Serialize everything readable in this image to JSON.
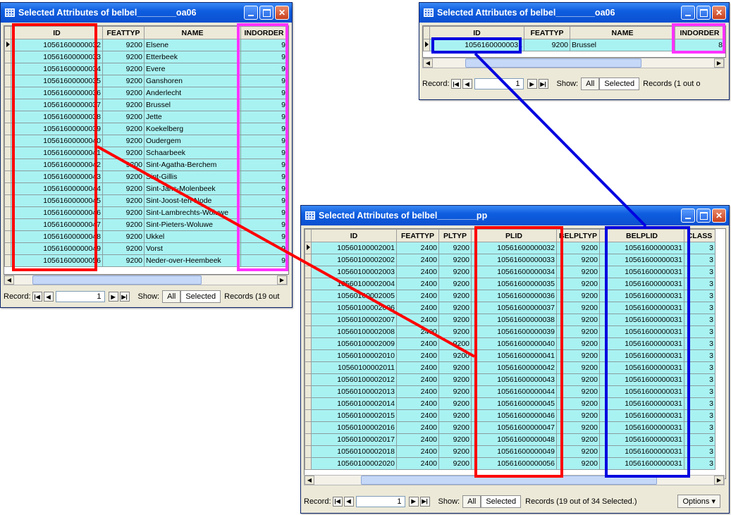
{
  "windows": {
    "oa06_left": {
      "title": "Selected Attributes of belbel________oa06",
      "columns": [
        "ID",
        "FEATTYP",
        "NAME",
        "INDORDER"
      ],
      "rows": [
        [
          "10561600000032",
          "9200",
          "Elsene",
          "9"
        ],
        [
          "10561600000033",
          "9200",
          "Etterbeek",
          "9"
        ],
        [
          "10561600000034",
          "9200",
          "Evere",
          "9"
        ],
        [
          "10561600000035",
          "9200",
          "Ganshoren",
          "9"
        ],
        [
          "10561600000036",
          "9200",
          "Anderlecht",
          "9"
        ],
        [
          "10561600000037",
          "9200",
          "Brussel",
          "9"
        ],
        [
          "10561600000038",
          "9200",
          "Jette",
          "9"
        ],
        [
          "10561600000039",
          "9200",
          "Koekelberg",
          "9"
        ],
        [
          "10561600000040",
          "9200",
          "Oudergem",
          "9"
        ],
        [
          "10561600000041",
          "9200",
          "Schaarbeek",
          "9"
        ],
        [
          "10561600000042",
          "9200",
          "Sint-Agatha-Berchem",
          "9"
        ],
        [
          "10561600000043",
          "9200",
          "Sint-Gillis",
          "9"
        ],
        [
          "10561600000044",
          "9200",
          "Sint-Jans-Molenbeek",
          "9"
        ],
        [
          "10561600000045",
          "9200",
          "Sint-Joost-ten-Node",
          "9"
        ],
        [
          "10561600000046",
          "9200",
          "Sint-Lambrechts-Woluwe",
          "9"
        ],
        [
          "10561600000047",
          "9200",
          "Sint-Pieters-Woluwe",
          "9"
        ],
        [
          "10561600000048",
          "9200",
          "Ukkel",
          "9"
        ],
        [
          "10561600000049",
          "9200",
          "Vorst",
          "9"
        ],
        [
          "10561600000056",
          "9200",
          "Neder-over-Heembeek",
          "9"
        ]
      ],
      "status": {
        "record_label": "Record:",
        "record_value": "1",
        "show_label": "Show:",
        "all_label": "All",
        "selected_label": "Selected",
        "records_text": "Records (19 out"
      }
    },
    "oa06_right": {
      "title": "Selected Attributes of belbel________oa06",
      "columns": [
        "ID",
        "FEATTYP",
        "NAME",
        "INDORDER"
      ],
      "rows": [
        [
          "10561600000031",
          "9200",
          "Brussel",
          "8"
        ]
      ],
      "status": {
        "record_label": "Record:",
        "record_value": "1",
        "show_label": "Show:",
        "all_label": "All",
        "selected_label": "Selected",
        "records_text": "Records (1 out o"
      }
    },
    "pp": {
      "title": "Selected Attributes of belbel________pp",
      "columns": [
        "ID",
        "FEATTYP",
        "PLTYP",
        "PLID",
        "BELPLTYP",
        "BELPLID",
        "CLASS"
      ],
      "rows": [
        [
          "10560100002001",
          "2400",
          "9200",
          "10561600000032",
          "9200",
          "10561600000031",
          "3"
        ],
        [
          "10560100002002",
          "2400",
          "9200",
          "10561600000033",
          "9200",
          "10561600000031",
          "3"
        ],
        [
          "10560100002003",
          "2400",
          "9200",
          "10561600000034",
          "9200",
          "10561600000031",
          "3"
        ],
        [
          "10560100002004",
          "2400",
          "9200",
          "10561600000035",
          "9200",
          "10561600000031",
          "3"
        ],
        [
          "10560100002005",
          "2400",
          "9200",
          "10561600000036",
          "9200",
          "10561600000031",
          "3"
        ],
        [
          "10560100002006",
          "2400",
          "9200",
          "10561600000037",
          "9200",
          "10561600000031",
          "3"
        ],
        [
          "10560100002007",
          "2400",
          "9200",
          "10561600000038",
          "9200",
          "10561600000031",
          "3"
        ],
        [
          "10560100002008",
          "2400",
          "9200",
          "10561600000039",
          "9200",
          "10561600000031",
          "3"
        ],
        [
          "10560100002009",
          "2400",
          "9200",
          "10561600000040",
          "9200",
          "10561600000031",
          "3"
        ],
        [
          "10560100002010",
          "2400",
          "9200",
          "10561600000041",
          "9200",
          "10561600000031",
          "3"
        ],
        [
          "10560100002011",
          "2400",
          "9200",
          "10561600000042",
          "9200",
          "10561600000031",
          "3"
        ],
        [
          "10560100002012",
          "2400",
          "9200",
          "10561600000043",
          "9200",
          "10561600000031",
          "3"
        ],
        [
          "10560100002013",
          "2400",
          "9200",
          "10561600000044",
          "9200",
          "10561600000031",
          "3"
        ],
        [
          "10560100002014",
          "2400",
          "9200",
          "10561600000045",
          "9200",
          "10561600000031",
          "3"
        ],
        [
          "10560100002015",
          "2400",
          "9200",
          "10561600000046",
          "9200",
          "10561600000031",
          "3"
        ],
        [
          "10560100002016",
          "2400",
          "9200",
          "10561600000047",
          "9200",
          "10561600000031",
          "3"
        ],
        [
          "10560100002017",
          "2400",
          "9200",
          "10561600000048",
          "9200",
          "10561600000031",
          "3"
        ],
        [
          "10560100002018",
          "2400",
          "9200",
          "10561600000049",
          "9200",
          "10561600000031",
          "3"
        ],
        [
          "10560100002020",
          "2400",
          "9200",
          "10561600000056",
          "9200",
          "10561600000031",
          "3"
        ]
      ],
      "status": {
        "record_label": "Record:",
        "record_value": "1",
        "show_label": "Show:",
        "all_label": "All",
        "selected_label": "Selected",
        "records_text": "Records (19 out of 34 Selected.)",
        "options_label": "Options"
      }
    }
  },
  "colors": {
    "cell_bg": "#a9f2f2",
    "highlight_red": "#ff0000",
    "highlight_magenta": "#ff33ff",
    "highlight_blue": "#0000e0"
  }
}
